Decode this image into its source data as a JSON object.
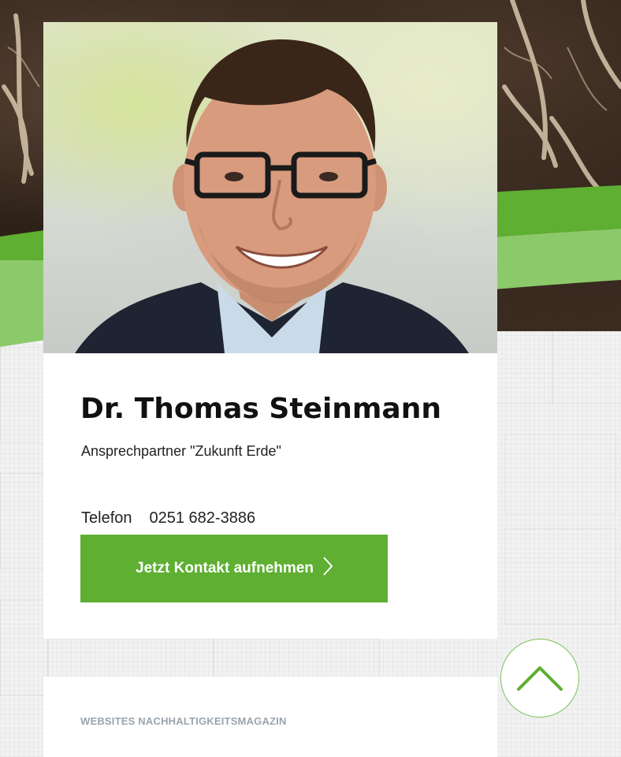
{
  "person": {
    "name": "Dr. Thomas Steinmann",
    "role": "Ansprechpartner \"Zukunft Erde\"",
    "phone_label": "Telefon",
    "phone_number": "0251 682-3886"
  },
  "actions": {
    "contact_label": "Jetzt Kontakt aufnehmen"
  },
  "footer_card": {
    "title": "WEBSITES NACHHALTIGKEITSMAGAZIN"
  },
  "icons": {
    "contact_chevron": "chevron-right-icon",
    "scroll_top": "chevron-up-icon"
  },
  "colors": {
    "accent_green": "#5eaf32",
    "light_green": "#8cc96a",
    "muted_text": "#9aa4ad"
  }
}
